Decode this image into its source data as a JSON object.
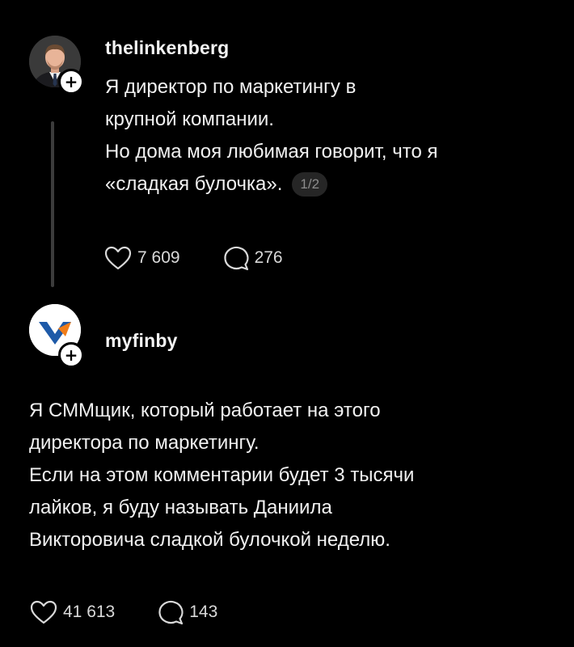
{
  "posts": [
    {
      "username": "thelinkenberg",
      "lines": [
        "Я директор по маркетингу в",
        "крупной компании.",
        "Но дома моя любимая говорит, что я",
        "«сладкая булочка»."
      ],
      "pager": "1/2",
      "likes": "7 609",
      "comments": "276"
    },
    {
      "username": "myfinby",
      "lines": [
        "Я СММщик, который работает на этого",
        "директора по маркетингу.",
        "Если на этом комментарии будет 3 тысячи",
        "лайков, я буду называть Даниила",
        "Викторовича сладкой булочкой неделю."
      ],
      "likes": "41 613",
      "comments": "143"
    }
  ],
  "icons": {
    "like": "heart-icon",
    "comment": "comment-icon",
    "follow": "plus-icon"
  },
  "colors": {
    "background": "#000000",
    "text": "#f3f3f3",
    "muted": "#8c8c8c",
    "logo_blue": "#1e5aa8",
    "logo_orange": "#f07d1a"
  }
}
